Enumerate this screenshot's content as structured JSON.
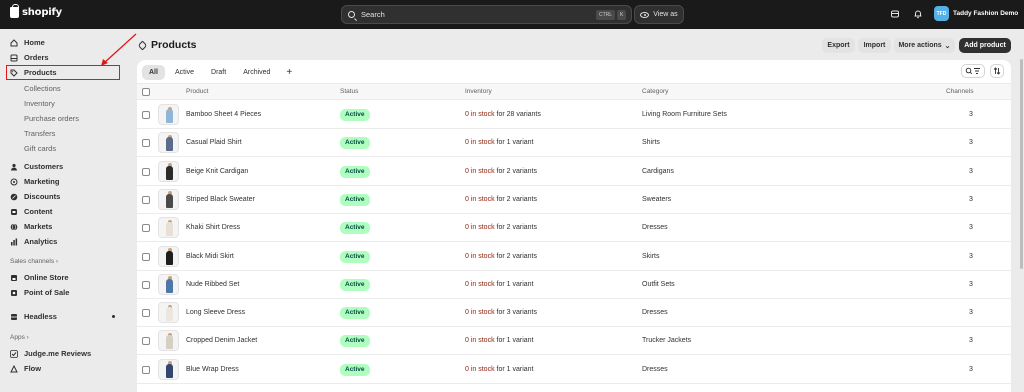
{
  "topbar": {
    "brand": "shopify",
    "search_placeholder": "Search",
    "kbd_ctrl": "CTRL",
    "kbd_k": "K",
    "view_as": "View as",
    "store_initials": "TFD",
    "store_name": "Taddy Fashion Demo"
  },
  "sidebar": {
    "items": [
      {
        "label": "Home",
        "icon": "home-icon"
      },
      {
        "label": "Orders",
        "icon": "inbox-icon"
      },
      {
        "label": "Products",
        "icon": "tag-icon"
      },
      {
        "label": "Collections"
      },
      {
        "label": "Inventory"
      },
      {
        "label": "Purchase orders"
      },
      {
        "label": "Transfers"
      },
      {
        "label": "Gift cards"
      },
      {
        "label": "Customers",
        "icon": "person-icon"
      },
      {
        "label": "Marketing",
        "icon": "target-icon"
      },
      {
        "label": "Discounts",
        "icon": "discount-icon"
      },
      {
        "label": "Content",
        "icon": "content-icon"
      },
      {
        "label": "Markets",
        "icon": "globe-icon"
      },
      {
        "label": "Analytics",
        "icon": "chart-icon"
      }
    ],
    "sales_channels_label": "Sales channels",
    "channels": [
      {
        "label": "Online Store",
        "icon": "store-icon"
      },
      {
        "label": "Point of Sale",
        "icon": "pos-icon"
      }
    ],
    "headless": "Headless",
    "apps_label": "Apps",
    "apps": [
      {
        "label": "Judge.me Reviews",
        "icon": "check-icon"
      },
      {
        "label": "Flow",
        "icon": "flow-icon"
      }
    ]
  },
  "header": {
    "title": "Products",
    "export": "Export",
    "import": "Import",
    "more_actions": "More actions",
    "add_product": "Add product"
  },
  "tabs": [
    "All",
    "Active",
    "Draft",
    "Archived"
  ],
  "columns": {
    "product": "Product",
    "status": "Status",
    "inventory": "Inventory",
    "category": "Category",
    "channels": "Channels"
  },
  "rows": [
    {
      "name": "Bamboo Sheet 4 Pieces",
      "status": "Active",
      "stock": "0 in stock",
      "variants": " for 28 variants",
      "category": "Living Room Furniture Sets",
      "channels": "3",
      "color": "#8fb6d6"
    },
    {
      "name": "Casual Plaid Shirt",
      "status": "Active",
      "stock": "0 in stock",
      "variants": " for 1 variant",
      "category": "Shirts",
      "channels": "3",
      "color": "#5a6b8c"
    },
    {
      "name": "Beige Knit Cardigan",
      "status": "Active",
      "stock": "0 in stock",
      "variants": " for 2 variants",
      "category": "Cardigans",
      "channels": "3",
      "color": "#2a2a2a"
    },
    {
      "name": "Striped Black Sweater",
      "status": "Active",
      "stock": "0 in stock",
      "variants": " for 2 variants",
      "category": "Sweaters",
      "channels": "3",
      "color": "#4a4a4a"
    },
    {
      "name": "Khaki Shirt Dress",
      "status": "Active",
      "stock": "0 in stock",
      "variants": " for 2 variants",
      "category": "Dresses",
      "channels": "3",
      "color": "#e8e0d6"
    },
    {
      "name": "Black Midi Skirt",
      "status": "Active",
      "stock": "0 in stock",
      "variants": " for 2 variants",
      "category": "Skirts",
      "channels": "3",
      "color": "#1e1e1e"
    },
    {
      "name": "Nude Ribbed Set",
      "status": "Active",
      "stock": "0 in stock",
      "variants": " for 1 variant",
      "category": "Outfit Sets",
      "channels": "3",
      "color": "#4d77a8"
    },
    {
      "name": "Long Sleeve Dress",
      "status": "Active",
      "stock": "0 in stock",
      "variants": " for 3 variants",
      "category": "Dresses",
      "channels": "3",
      "color": "#ece6e0"
    },
    {
      "name": "Cropped Denim Jacket",
      "status": "Active",
      "stock": "0 in stock",
      "variants": " for 1 variant",
      "category": "Trucker Jackets",
      "channels": "3",
      "color": "#d8cfc4"
    },
    {
      "name": "Blue Wrap Dress",
      "status": "Active",
      "stock": "0 in stock",
      "variants": " for 1 variant",
      "category": "Dresses",
      "channels": "3",
      "color": "#33466e"
    }
  ]
}
